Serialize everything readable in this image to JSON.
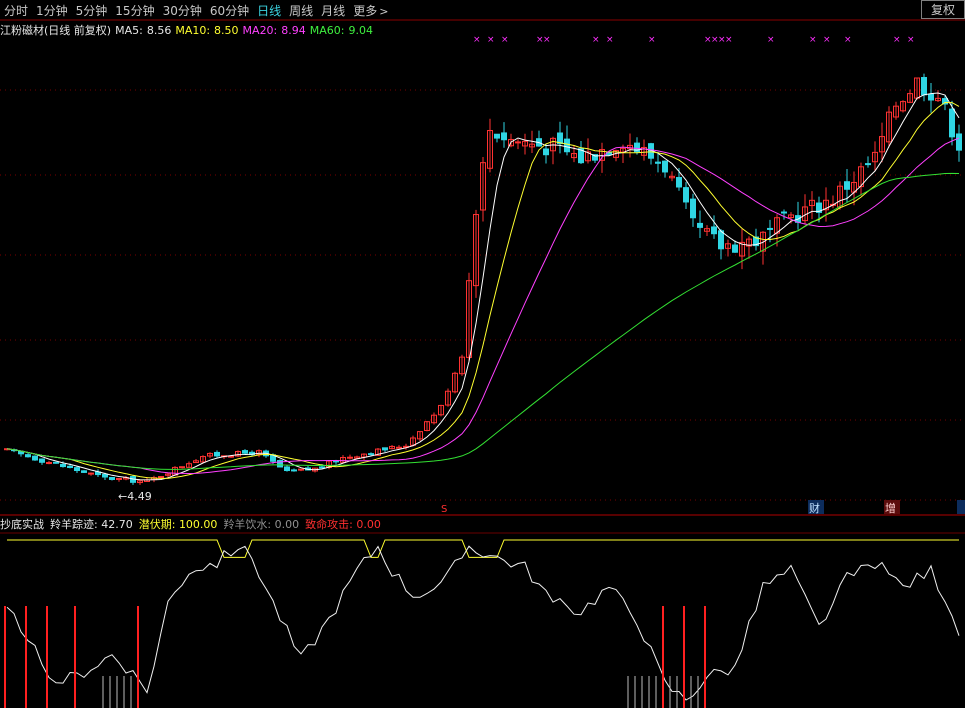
{
  "toolbar": {
    "tabs": [
      {
        "label": "分时",
        "active": false
      },
      {
        "label": "1分钟",
        "active": false
      },
      {
        "label": "5分钟",
        "active": false
      },
      {
        "label": "15分钟",
        "active": false
      },
      {
        "label": "30分钟",
        "active": false
      },
      {
        "label": "60分钟",
        "active": false
      },
      {
        "label": "日线",
        "active": true
      },
      {
        "label": "周线",
        "active": false
      },
      {
        "label": "月线",
        "active": false
      },
      {
        "label": "更多",
        "active": false
      }
    ],
    "more_icon": ">",
    "fq_label": "复权"
  },
  "legend": {
    "title": "江粉磁材(日线 前复权)",
    "ma5_label": "MA5:",
    "ma5": "8.56",
    "ma10_label": "MA10:",
    "ma10": "8.50",
    "ma20_label": "MA20:",
    "ma20": "8.94",
    "ma60_label": "MA60:",
    "ma60": "9.04"
  },
  "low_label": "←4.49",
  "markers": {
    "s": "S",
    "cai": "财",
    "zeng": "增"
  },
  "indicator": {
    "name": "抄底实战",
    "l1": "羚羊踪迹:",
    "v1": "42.70",
    "l2": "潜伏期:",
    "v2": "100.00",
    "l3": "羚羊饮水:",
    "v3": "0.00",
    "l4": "致命攻击:",
    "v4": "0.00"
  },
  "colors": {
    "up": "#ff3232",
    "down": "#2fd6e4",
    "ma5": "#ffffff",
    "ma10": "#ffff30",
    "ma20": "#ff40ff",
    "ma60": "#33e033",
    "grid": "#7a0000"
  }
}
